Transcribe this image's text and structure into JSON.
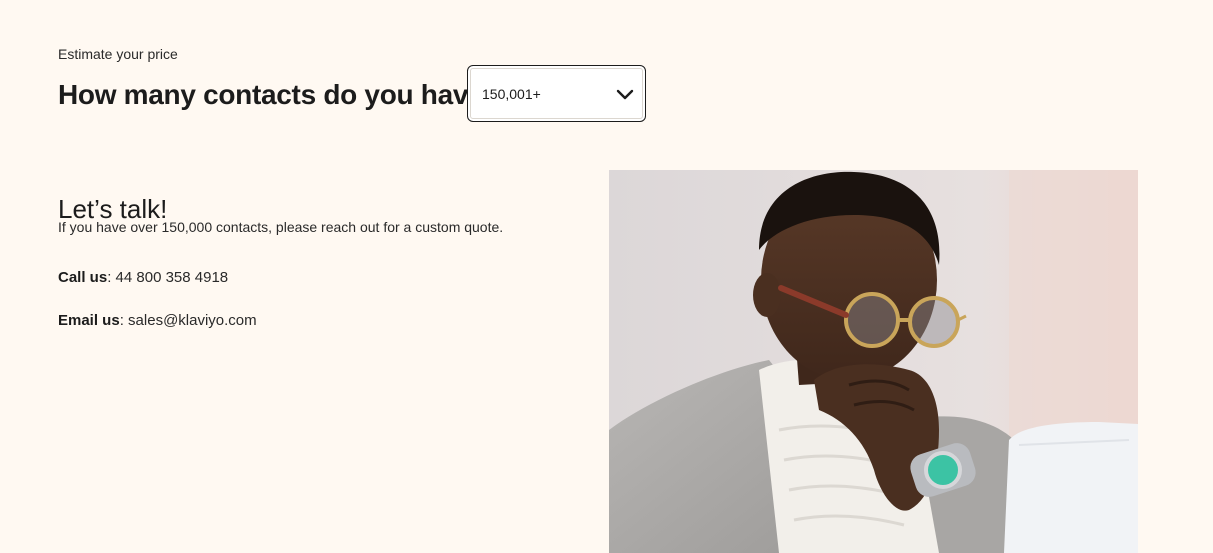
{
  "header": {
    "eyebrow": "Estimate your price",
    "question": "How many contacts do you have?"
  },
  "contacts_select": {
    "selected_value": "150,001+",
    "icon": "chevron-down-icon"
  },
  "talk": {
    "title": "Let’s talk!",
    "description": "If you have over 150,000 contacts, please reach out for a custom quote.",
    "call_label": "Call us",
    "call_value": "44 800 358 4918",
    "email_label": "Email us",
    "email_value": "sales@klaviyo.com"
  },
  "colors": {
    "background": "#fff9f2",
    "text": "#1c1c1c"
  }
}
